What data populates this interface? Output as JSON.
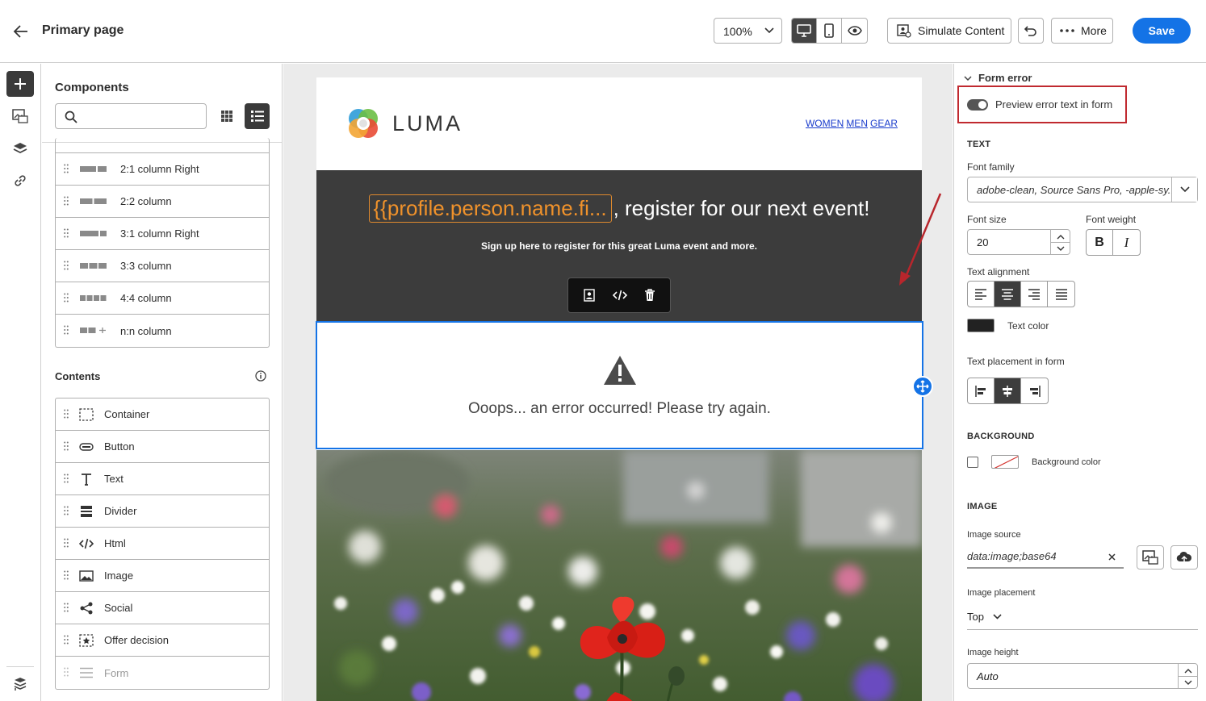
{
  "header": {
    "title": "Primary page",
    "zoom": "100%",
    "simulate_label": "Simulate Content",
    "more_label": "More",
    "save_label": "Save"
  },
  "components": {
    "title": "Components",
    "search_placeholder": "",
    "layouts": [
      "2:1 column Right",
      "2:2 column",
      "3:1 column Right",
      "3:3 column",
      "4:4 column",
      "n:n column"
    ],
    "contents_title": "Contents",
    "contents": [
      "Container",
      "Button",
      "Text",
      "Divider",
      "Html",
      "Image",
      "Social",
      "Offer decision",
      "Form"
    ]
  },
  "email": {
    "logo_text": "LUMA",
    "nav": [
      "WOMEN",
      "MEN",
      "GEAR"
    ],
    "hero_token": "{{profile.person.name.fi...",
    "hero_title_rest": ", register for our next event!",
    "hero_subtitle": "Sign up here to register for this great Luma event and more.",
    "error_text": "Ooops... an error occurred! Please try again."
  },
  "props": {
    "section_title": "Form error",
    "toggle_label": "Preview error text in form",
    "text_heading": "TEXT",
    "font_family_label": "Font family",
    "font_family_value": "adobe-clean, Source Sans Pro, -apple-sy...",
    "font_size_label": "Font size",
    "font_size_value": "20",
    "font_weight_label": "Font weight",
    "bold": "B",
    "italic": "I",
    "alignment_label": "Text alignment",
    "text_color_label": "Text color",
    "text_color": "#222222",
    "placement_label": "Text placement in form",
    "bg_heading": "BACKGROUND",
    "bg_color_label": "Background color",
    "image_heading": "IMAGE",
    "image_source_label": "Image source",
    "image_source_value": "data:image;base64",
    "image_placement_label": "Image placement",
    "image_placement_value": "Top",
    "image_height_label": "Image height",
    "image_height_value": "Auto"
  },
  "colors": {
    "accent": "#1473e6",
    "highlight": "#c0292f",
    "token": "#f0922b"
  }
}
